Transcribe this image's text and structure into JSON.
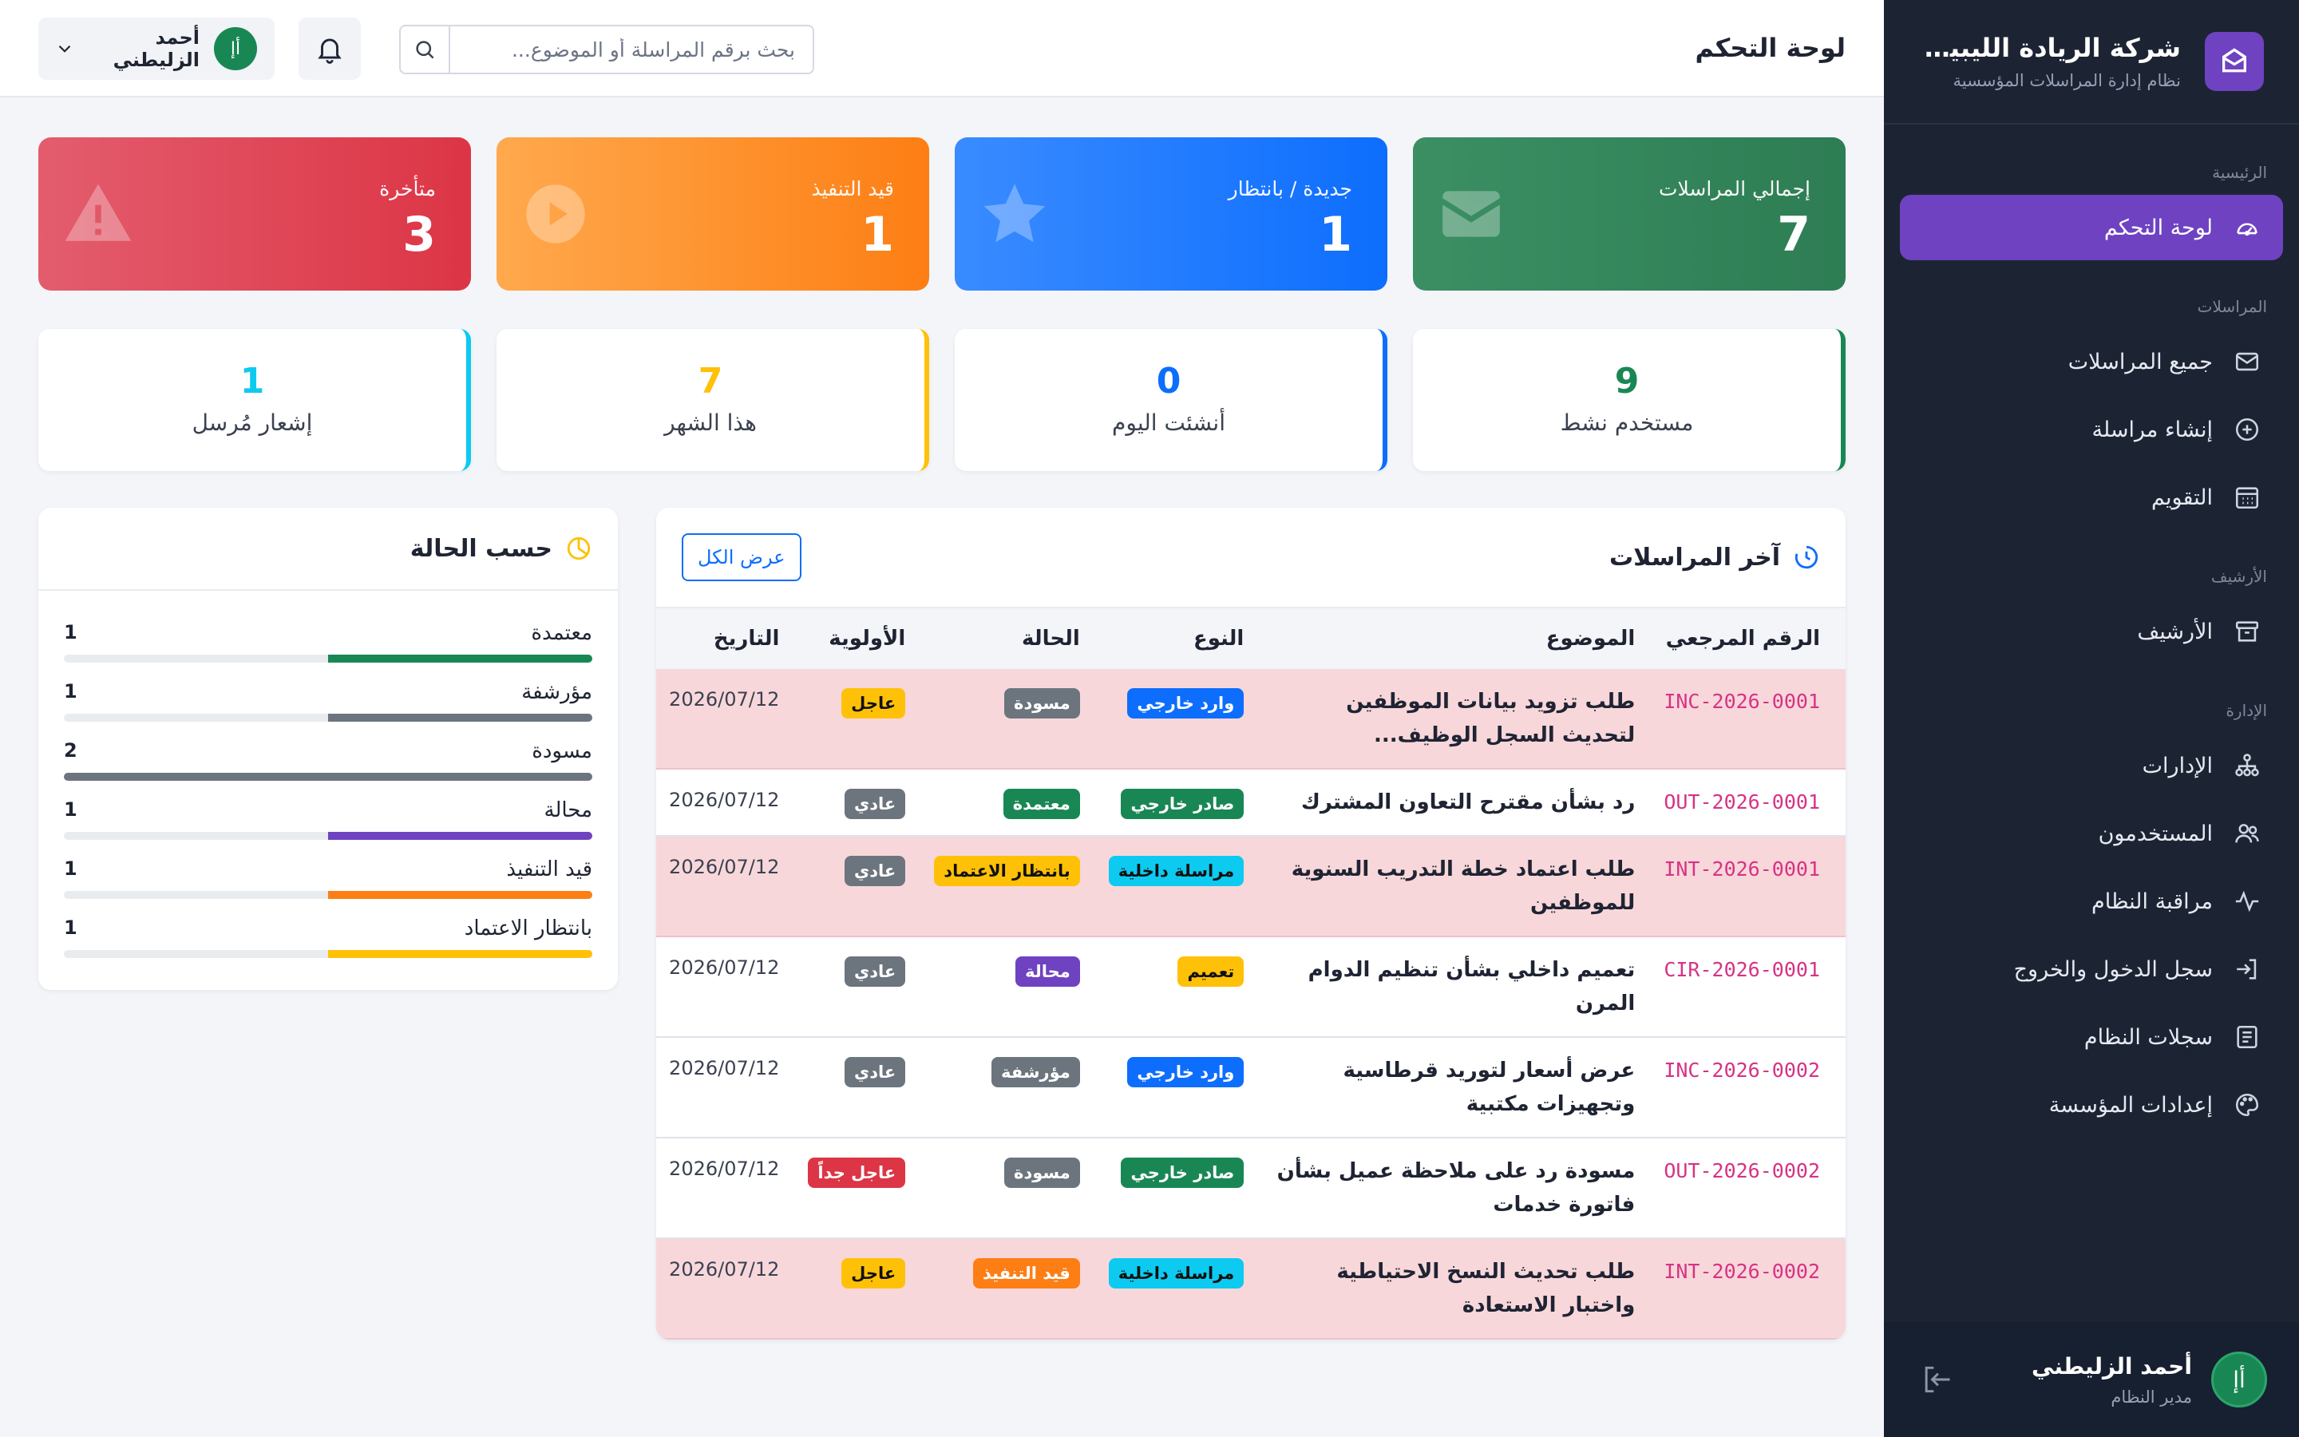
{
  "brand": {
    "name": "شركة الريادة الليبية للحـ..",
    "subtitle": "نظام إدارة المراسلات المؤسسية"
  },
  "nav": {
    "sections": [
      {
        "label": "الرئيسية",
        "items": [
          {
            "label": "لوحة التحكم",
            "icon": "gauge-icon",
            "active": true
          }
        ]
      },
      {
        "label": "المراسلات",
        "items": [
          {
            "label": "جميع المراسلات",
            "icon": "envelope-icon"
          },
          {
            "label": "إنشاء مراسلة",
            "icon": "plus-circle-icon"
          },
          {
            "label": "التقويم",
            "icon": "calendar-icon"
          }
        ]
      },
      {
        "label": "الأرشيف",
        "items": [
          {
            "label": "الأرشيف",
            "icon": "archive-icon"
          }
        ]
      },
      {
        "label": "الإدارة",
        "items": [
          {
            "label": "الإدارات",
            "icon": "sitemap-icon"
          },
          {
            "label": "المستخدمون",
            "icon": "users-icon"
          },
          {
            "label": "مراقبة النظام",
            "icon": "activity-icon"
          },
          {
            "label": "سجل الدخول والخروج",
            "icon": "login-icon"
          },
          {
            "label": "سجلات النظام",
            "icon": "log-list-icon"
          },
          {
            "label": "إعدادات المؤسسة",
            "icon": "palette-icon"
          }
        ]
      }
    ]
  },
  "sidebar_user": {
    "name": "أحمد الزليطني",
    "role": "مدير النظام",
    "initials": "أإ"
  },
  "topbar": {
    "title": "لوحة التحكم",
    "search_placeholder": "بحث برقم المراسلة أو الموضوع...",
    "user_name": "أحمد الزليطني",
    "user_initials": "أإ"
  },
  "stats": [
    {
      "label": "إجمالي المراسلات",
      "value": "7",
      "icon": "envelope-icon",
      "color": "#2e7d54"
    },
    {
      "label": "جديدة / بانتظار",
      "value": "1",
      "icon": "star-icon",
      "color": "#0d6efd"
    },
    {
      "label": "قيد التنفيذ",
      "value": "1",
      "icon": "play-icon",
      "color": "#fd7e14"
    },
    {
      "label": "متأخرة",
      "value": "3",
      "icon": "warning-icon",
      "color": "#dc3545"
    }
  ],
  "mini_stats": [
    {
      "label": "مستخدم نشط",
      "value": "9"
    },
    {
      "label": "أنشئت اليوم",
      "value": "0"
    },
    {
      "label": "هذا الشهر",
      "value": "7"
    },
    {
      "label": "إشعار مُرسل",
      "value": "1"
    }
  ],
  "recent": {
    "title": "آخر المراسلات",
    "view_all": "عرض الكل",
    "columns": [
      "الرقم المرجعي",
      "الموضوع",
      "النوع",
      "الحالة",
      "الأولوية",
      "التاريخ"
    ],
    "rows": [
      {
        "ref": "INC-2026-0001",
        "subject": "طلب تزويد بيانات الموظفين لتحديث السجل الوظيف...",
        "type": "وارد خارجي",
        "status": "مسودة",
        "priority": "عاجل",
        "date": "2026/07/12",
        "late": true
      },
      {
        "ref": "OUT-2026-0001",
        "subject": "رد بشأن مقترح التعاون المشترك",
        "type": "صادر خارجي",
        "status": "معتمدة",
        "priority": "عادي",
        "date": "2026/07/12",
        "late": false
      },
      {
        "ref": "INT-2026-0001",
        "subject": "طلب اعتماد خطة التدريب السنوية للموظفين",
        "type": "مراسلة داخلية",
        "status": "بانتظار الاعتماد",
        "priority": "عادي",
        "date": "2026/07/12",
        "late": true
      },
      {
        "ref": "CIR-2026-0001",
        "subject": "تعميم داخلي بشأن تنظيم الدوام المرن",
        "type": "تعميم",
        "status": "محالة",
        "priority": "عادي",
        "date": "2026/07/12",
        "late": false
      },
      {
        "ref": "INC-2026-0002",
        "subject": "عرض أسعار لتوريد قرطاسية وتجهيزات مكتبية",
        "type": "وارد خارجي",
        "status": "مؤرشفة",
        "priority": "عادي",
        "date": "2026/07/12",
        "late": false
      },
      {
        "ref": "OUT-2026-0002",
        "subject": "مسودة رد على ملاحظة عميل بشأن فاتورة خدمات",
        "type": "صادر خارجي",
        "status": "مسودة",
        "priority": "عاجل جداً",
        "date": "2026/07/12",
        "late": false
      },
      {
        "ref": "INT-2026-0002",
        "subject": "طلب تحديث النسخ الاحتياطية واختبار الاستعادة",
        "type": "مراسلة داخلية",
        "status": "قيد التنفيذ",
        "priority": "عاجل",
        "date": "2026/07/12",
        "late": true
      }
    ]
  },
  "by_status": {
    "title": "حسب الحالة",
    "max": 2,
    "items": [
      {
        "label": "معتمدة",
        "count": 1,
        "color": "#198754"
      },
      {
        "label": "مؤرشفة",
        "count": 1,
        "color": "#6c757d"
      },
      {
        "label": "مسودة",
        "count": 2,
        "color": "#6c757d"
      },
      {
        "label": "محالة",
        "count": 1,
        "color": "#6f42c1"
      },
      {
        "label": "قيد التنفيذ",
        "count": 1,
        "color": "#fd7e14"
      },
      {
        "label": "بانتظار الاعتماد",
        "count": 1,
        "color": "#ffc107"
      }
    ]
  }
}
